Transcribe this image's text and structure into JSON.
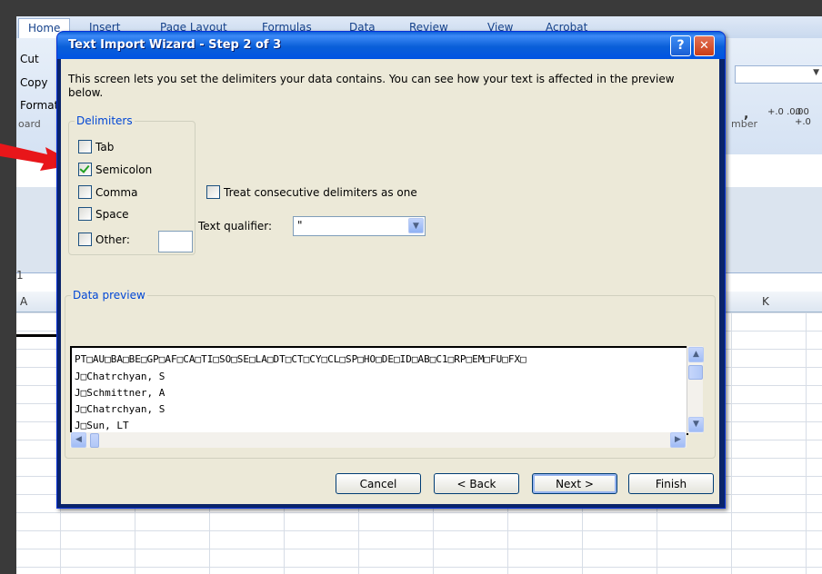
{
  "excel": {
    "tabs": [
      "Home",
      "Insert",
      "Page Layout",
      "Formulas",
      "Data",
      "Review",
      "View",
      "Acrobat"
    ],
    "ribbon_items": [
      "Cut",
      "Copy",
      "Format"
    ],
    "group_clipboard": "oard",
    "group_number": "mber",
    "number_format_symbols": [
      ",",
      "+.0 .00",
      ".00 +.0"
    ],
    "row_label": "1",
    "columns": [
      "A",
      "K"
    ]
  },
  "dialog": {
    "title": "Text Import Wizard - Step 2 of 3",
    "help_label": "?",
    "close_label": "✕",
    "intro": "This screen lets you set the delimiters your data contains.  You can see how your text is affected in the preview below.",
    "delimiters_label": "Delimiters",
    "delimiters": [
      {
        "label": "Tab",
        "checked": false
      },
      {
        "label": "Semicolon",
        "checked": true
      },
      {
        "label": "Comma",
        "checked": false
      },
      {
        "label": "Space",
        "checked": false
      },
      {
        "label": "Other:",
        "checked": false
      }
    ],
    "consecutive_label": "Treat consecutive delimiters as one",
    "consecutive_checked": false,
    "text_qualifier_label": "Text qualifier:",
    "text_qualifier_value": "\"",
    "data_preview_label": "Data preview",
    "preview_lines": [
      "PT□AU□BA□BE□GP□AF□CA□TI□SO□SE□LA□DT□CT□CY□CL□SP□HO□DE□ID□AB□C1□RP□EM□FU□FX□",
      "J□Chatrchyan, S",
      "J□Schmittner, A",
      "J□Chatrchyan, S",
      "J□Sun, LT"
    ],
    "buttons": {
      "cancel": "Cancel",
      "back": "< Back",
      "next": "Next >",
      "finish": "Finish"
    }
  },
  "colors": {
    "title_bar": "#0054e3",
    "dialog_face": "#ece9d8",
    "arrow": "#e8161a",
    "group_label": "#0046d5"
  }
}
